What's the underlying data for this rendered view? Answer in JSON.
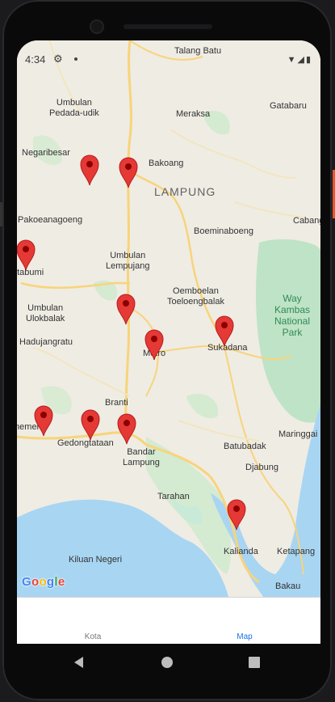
{
  "status": {
    "time": "4:34",
    "icons": "▼◢▮"
  },
  "map": {
    "labels": [
      {
        "text": "Talang Batu"
      },
      {
        "text": "Umbulan\nPedada-udik"
      },
      {
        "text": "Meraksa"
      },
      {
        "text": "Gatabaru"
      },
      {
        "text": "Negaribesar"
      },
      {
        "text": "Bakoang"
      },
      {
        "text": "LAMPUNG"
      },
      {
        "text": "Pakoeanagoeng"
      },
      {
        "text": "Cabang"
      },
      {
        "text": "Boeminaboeng"
      },
      {
        "text": "otabumi"
      },
      {
        "text": "Umbulan\nLempujang"
      },
      {
        "text": "Oemboelan\nToeloengbalak"
      },
      {
        "text": "Way Kambas\nNational Park"
      },
      {
        "text": "Umbulan\nUlokbalak"
      },
      {
        "text": "Hadujangratu"
      },
      {
        "text": "Metro"
      },
      {
        "text": "Sukadana"
      },
      {
        "text": "Branti"
      },
      {
        "text": "Maringgai"
      },
      {
        "text": "memen"
      },
      {
        "text": "Gedongtataan"
      },
      {
        "text": "Bandar\nLampung"
      },
      {
        "text": "Batubadak"
      },
      {
        "text": "Djabung"
      },
      {
        "text": "Tarahan"
      },
      {
        "text": "Kiluan Negeri"
      },
      {
        "text": "Kalianda"
      },
      {
        "text": "Ketapang"
      },
      {
        "text": "Bakau"
      }
    ],
    "attribution": [
      "G",
      "o",
      "o",
      "g",
      "l",
      "e"
    ]
  },
  "nav": {
    "tab_kota": "Kota",
    "tab_map": "Map"
  },
  "colors": {
    "accent": "#1a73e8",
    "pin": "#e53935",
    "water": "#a8d5f2",
    "park": "#bfe3c6",
    "road": "#f8d47a"
  }
}
